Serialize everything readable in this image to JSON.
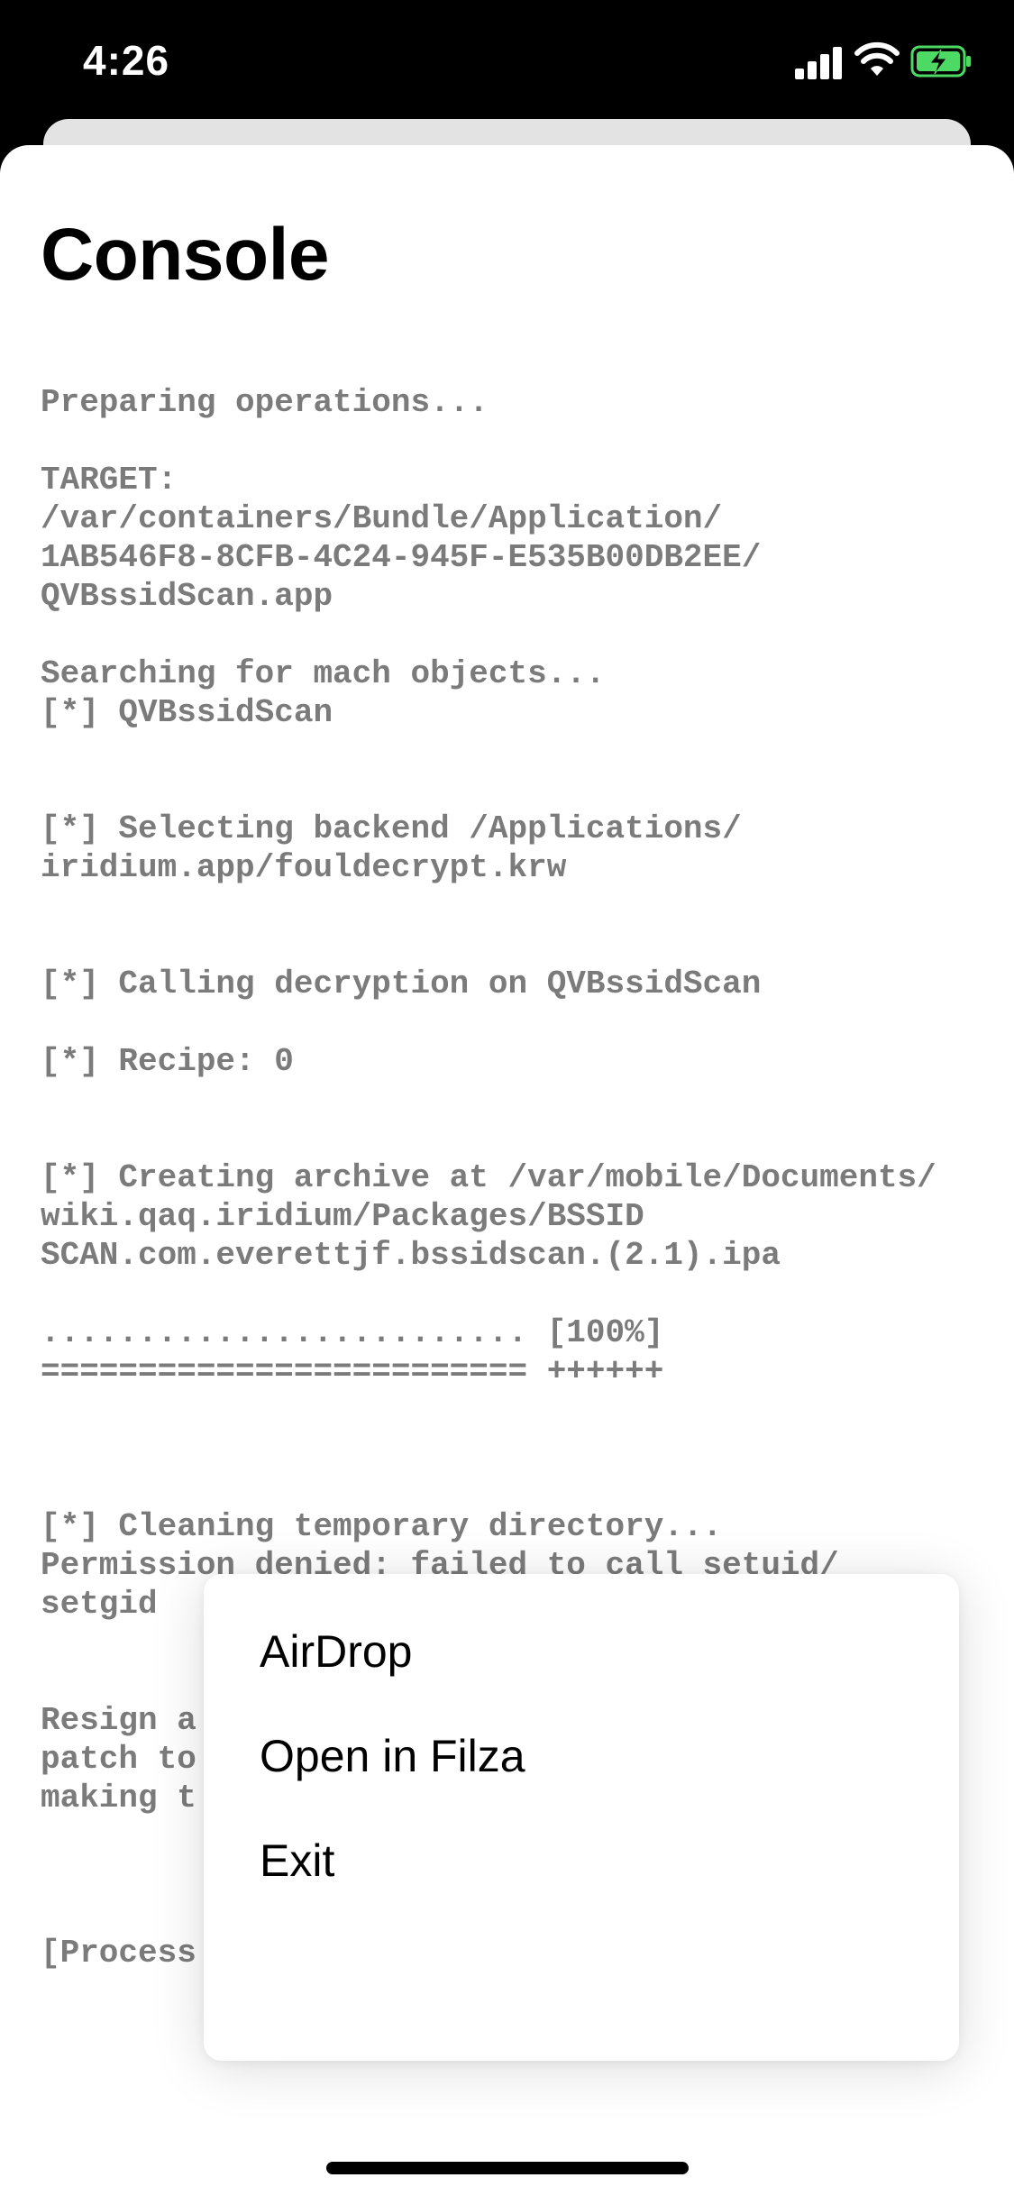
{
  "status_bar": {
    "time": "4:26",
    "icons": [
      "cellular-signal-icon",
      "wifi-icon",
      "battery-charging-icon"
    ],
    "battery_color": "#4cd964"
  },
  "screen": {
    "title": "Console"
  },
  "console_lines": [
    "Preparing operations...",
    "",
    "TARGET:",
    "/var/containers/Bundle/Application/",
    "1AB546F8-8CFB-4C24-945F-E535B00DB2EE/",
    "QVBssidScan.app",
    "",
    "Searching for mach objects...",
    "[*] QVBssidScan",
    "",
    "",
    "[*] Selecting backend /Applications/",
    "iridium.app/fouldecrypt.krw",
    "",
    "",
    "[*] Calling decryption on QVBssidScan",
    "",
    "[*] Recipe: 0",
    "",
    "",
    "[*] Creating archive at /var/mobile/Documents/",
    "wiki.qaq.iridium/Packages/BSSID",
    "SCAN.com.everettjf.bssidscan.(2.1).ipa",
    "",
    "......................... [100%]",
    "========================= ++++++",
    "",
    "",
    "",
    "[*] Cleaning temporary directory...",
    "Permission denied: failed to call setuid/",
    "setgid",
    "",
    "",
    "Resign a",
    "patch to",
    "making t",
    "",
    "",
    "",
    "[Process"
  ],
  "menu": {
    "items": [
      "AirDrop",
      "Open in Filza",
      "Exit"
    ]
  }
}
